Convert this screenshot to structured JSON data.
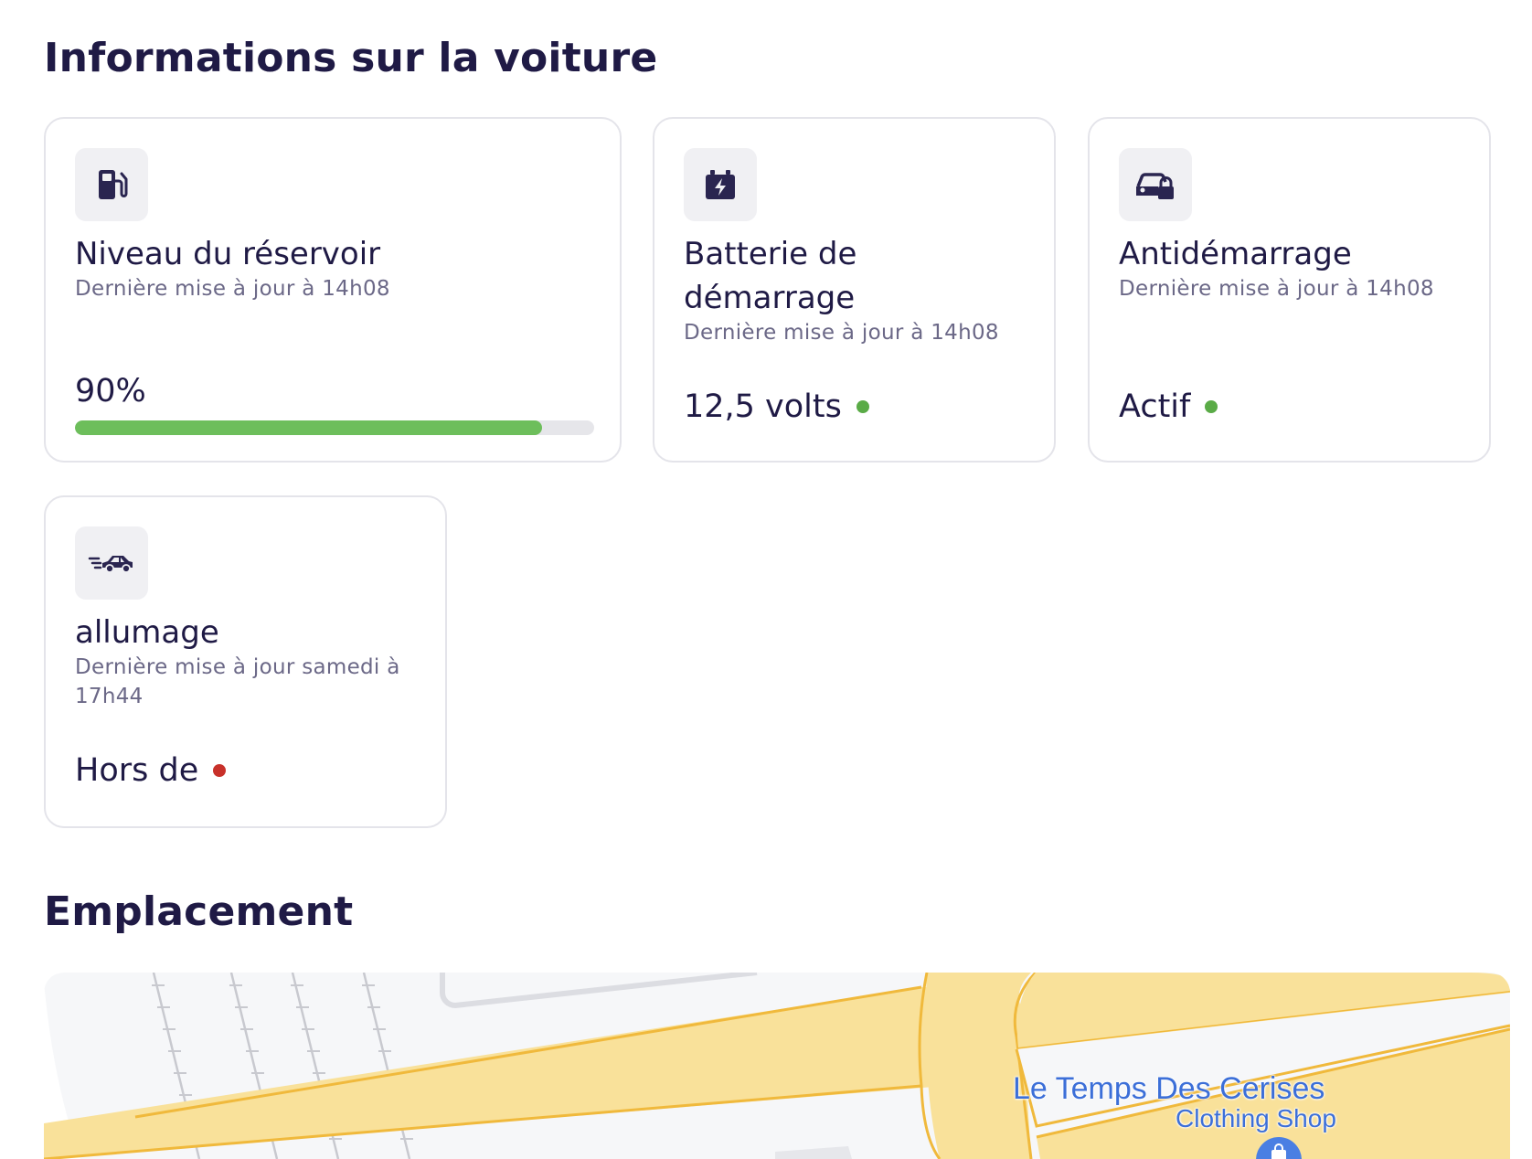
{
  "sections": {
    "car_info_title": "Informations sur la voiture",
    "location_title": "Emplacement"
  },
  "cards": {
    "fuel": {
      "icon": "fuel-pump-icon",
      "title": "Niveau du réservoir",
      "updated": "Dernière mise à jour à 14h08",
      "value": "90%",
      "level": 0.9,
      "bar_color": "#6dbe5b"
    },
    "battery": {
      "icon": "battery-icon",
      "title": "Batterie de démarrage",
      "updated": "Dernière mise à jour à 14h08",
      "value": "12,5 volts",
      "status_color": "#5aab47"
    },
    "immobilizer": {
      "icon": "car-lock-icon",
      "title": "Antidémarrage",
      "updated": "Dernière mise à jour à 14h08",
      "value": "Actif",
      "status_color": "#5aab47"
    },
    "ignition": {
      "icon": "moving-car-icon",
      "title": "allumage",
      "updated": "Dernière mise à jour samedi à 17h44",
      "value": "Hors de",
      "status_color": "#c8312a"
    }
  },
  "map": {
    "place_name": "Le Temps Des Cerises",
    "place_type": "Clothing Shop",
    "pin_icon": "shopping-bag-icon",
    "road_color": "#f9e19a",
    "road_border_color": "#f0b93c"
  }
}
